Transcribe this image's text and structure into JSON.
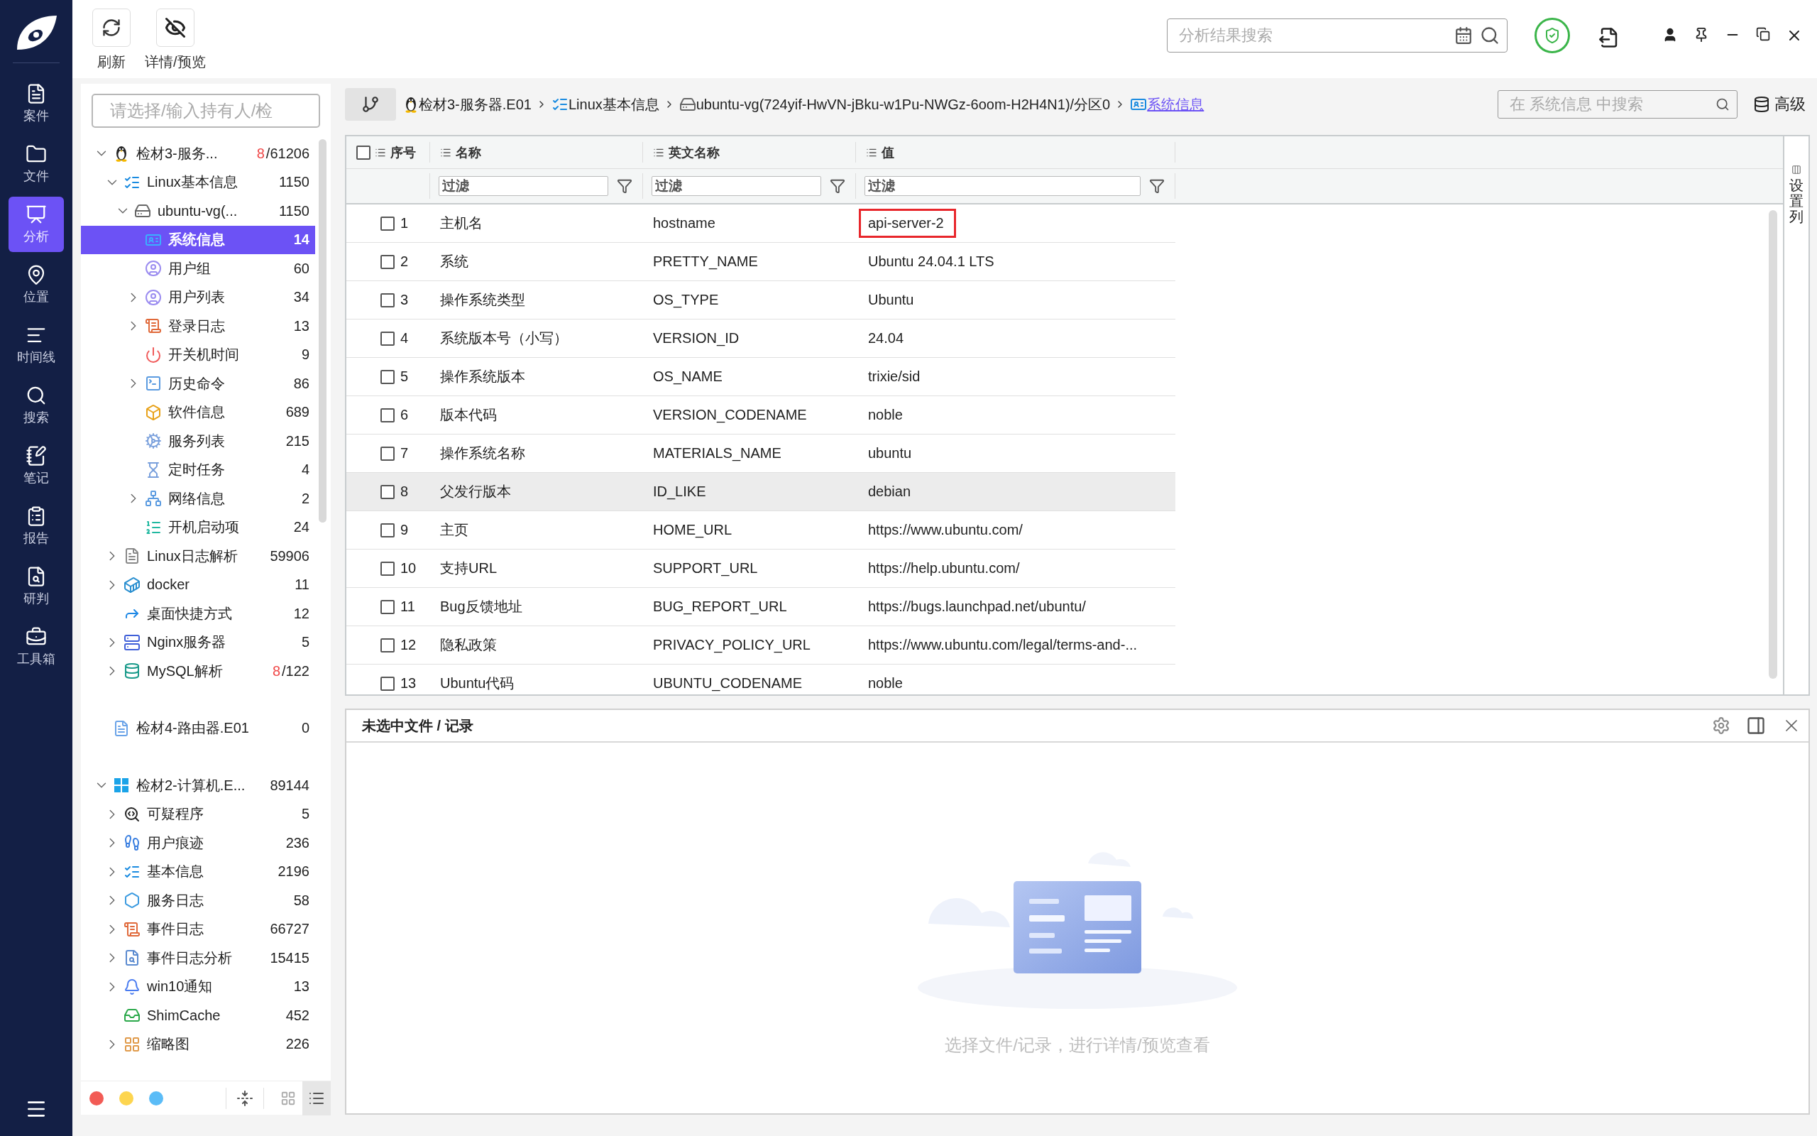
{
  "nav": {
    "items": [
      {
        "label": "案件",
        "selected": false
      },
      {
        "label": "文件",
        "selected": false
      },
      {
        "label": "分析",
        "selected": true
      },
      {
        "label": "位置",
        "selected": false
      },
      {
        "label": "时间线",
        "selected": false
      },
      {
        "label": "搜索",
        "selected": false
      },
      {
        "label": "笔记",
        "selected": false
      },
      {
        "label": "报告",
        "selected": false
      },
      {
        "label": "研判",
        "selected": false
      },
      {
        "label": "工具箱",
        "selected": false
      }
    ]
  },
  "toolbar": {
    "buttons": [
      {
        "kind": "refresh",
        "label": "刷新"
      },
      {
        "kind": "preview",
        "label": "详情/预览"
      }
    ],
    "search": {
      "placeholder": "分析结果搜索"
    }
  },
  "tree_panel": {
    "owner_select": {
      "placeholder": "请选择/输入持有人/检"
    },
    "tree": [
      {
        "label": "检材3-服务...",
        "kind": "linux",
        "alert": "8",
        "count": "/61206",
        "expanded": true,
        "selected": false,
        "children": [
          {
            "label": "Linux基本信息",
            "kind": "list",
            "count": "1150",
            "expanded": true,
            "selected": false,
            "children": [
              {
                "label": "ubuntu-vg(...",
                "kind": "disk",
                "count": "1150",
                "expanded": true,
                "selected": false,
                "children": [
                  {
                    "label": "系统信息",
                    "kind": "sysinfo",
                    "count": "14",
                    "selected": true
                  },
                  {
                    "label": "用户组",
                    "kind": "user",
                    "count": "60",
                    "selected": false
                  },
                  {
                    "label": "用户列表",
                    "kind": "user",
                    "count": "34",
                    "expanded": false,
                    "selected": false
                  },
                  {
                    "label": "登录日志",
                    "kind": "log-alert",
                    "count": "13",
                    "expanded": false,
                    "selected": false
                  },
                  {
                    "label": "开关机时间",
                    "kind": "power",
                    "count": "9",
                    "selected": false
                  },
                  {
                    "label": "历史命令",
                    "kind": "terminal",
                    "count": "86",
                    "expanded": false,
                    "selected": false
                  },
                  {
                    "label": "软件信息",
                    "kind": "cube",
                    "count": "689",
                    "selected": false
                  },
                  {
                    "label": "服务列表",
                    "kind": "gears",
                    "count": "215",
                    "selected": false
                  },
                  {
                    "label": "定时任务",
                    "kind": "hourglass",
                    "count": "4",
                    "selected": false
                  },
                  {
                    "label": "网络信息",
                    "kind": "network",
                    "count": "2",
                    "expanded": false,
                    "selected": false
                  },
                  {
                    "label": "开机启动项",
                    "kind": "startup",
                    "count": "24",
                    "selected": false
                  }
                ]
              }
            ]
          },
          {
            "label": "Linux日志解析",
            "kind": "logfile",
            "count": "59906",
            "expanded": false,
            "selected": false
          },
          {
            "label": "docker",
            "kind": "docker",
            "count": "11",
            "expanded": false,
            "selected": false
          },
          {
            "label": "桌面快捷方式",
            "kind": "shortcut",
            "count": "12",
            "selected": false
          },
          {
            "label": "Nginx服务器",
            "kind": "server",
            "count": "5",
            "expanded": false,
            "selected": false
          },
          {
            "label": "MySQL解析",
            "kind": "database",
            "alert": "8",
            "count": "/122",
            "expanded": false,
            "selected": false
          }
        ]
      },
      {
        "label": "检材4-路由器.E01",
        "kind": "file",
        "count": "0",
        "selected": false
      },
      {
        "label": "检材2-计算机.E...",
        "kind": "windows",
        "count": "89144",
        "expanded": true,
        "selected": false,
        "children": [
          {
            "label": "可疑程序",
            "kind": "suspicious",
            "count": "5",
            "expanded": false,
            "selected": false
          },
          {
            "label": "用户痕迹",
            "kind": "footprints",
            "count": "236",
            "expanded": false,
            "selected": false
          },
          {
            "label": "基本信息",
            "kind": "list",
            "count": "2196",
            "expanded": false,
            "selected": false
          },
          {
            "label": "服务日志",
            "kind": "service",
            "count": "58",
            "expanded": false,
            "selected": false
          },
          {
            "label": "事件日志",
            "kind": "log-alert",
            "count": "66727",
            "expanded": false,
            "selected": false
          },
          {
            "label": "事件日志分析",
            "kind": "log-search",
            "count": "15415",
            "expanded": false,
            "selected": false
          },
          {
            "label": "win10通知",
            "kind": "bell",
            "count": "13",
            "expanded": false,
            "selected": false
          },
          {
            "label": "ShimCache",
            "kind": "cache",
            "count": "452",
            "selected": false
          },
          {
            "label": "缩略图",
            "kind": "thumbnails",
            "count": "226",
            "expanded": false,
            "selected": false
          }
        ]
      }
    ],
    "color_filters": [
      {
        "color": "#f25b55"
      },
      {
        "color": "#fdd54f"
      },
      {
        "color": "#5bbcf7"
      }
    ],
    "views": [
      {
        "kind": "grid",
        "selected": false
      },
      {
        "kind": "list",
        "selected": true
      }
    ]
  },
  "breadcrumb": {
    "items": [
      {
        "label": "检材3-服务器.E01",
        "kind": "linux",
        "selected": false
      },
      {
        "label": "Linux基本信息",
        "kind": "list",
        "selected": false
      },
      {
        "label": "ubuntu-vg(724yif-HwVN-jBku-w1Pu-NWGz-6oom-H2H4N1)/分区0",
        "kind": "disk",
        "selected": false
      },
      {
        "label": "系统信息",
        "kind": "sysinfo",
        "selected": true
      }
    ],
    "search": {
      "placeholder": "在 系统信息 中搜索"
    },
    "advanced": "高级"
  },
  "table": {
    "select_all_checked": false,
    "columns": [
      {
        "label": "序号"
      },
      {
        "label": "名称",
        "placeholder": "过滤"
      },
      {
        "label": "英文名称",
        "placeholder": "过滤"
      },
      {
        "label": "值",
        "placeholder": "过滤"
      }
    ],
    "rows": [
      {
        "index": "1",
        "name": "主机名",
        "english_name": "hostname",
        "value": "api-server-2",
        "checked": false,
        "selected": false,
        "marked": true
      },
      {
        "index": "2",
        "name": "系统",
        "english_name": "PRETTY_NAME",
        "value": "Ubuntu 24.04.1 LTS",
        "checked": false,
        "selected": false,
        "marked": false
      },
      {
        "index": "3",
        "name": "操作系统类型",
        "english_name": "OS_TYPE",
        "value": "Ubuntu",
        "checked": false,
        "selected": false,
        "marked": false
      },
      {
        "index": "4",
        "name": "系统版本号（小写）",
        "english_name": "VERSION_ID",
        "value": "24.04",
        "checked": false,
        "selected": false,
        "marked": false
      },
      {
        "index": "5",
        "name": "操作系统版本",
        "english_name": "OS_NAME",
        "value": "trixie/sid",
        "checked": false,
        "selected": false,
        "marked": false
      },
      {
        "index": "6",
        "name": "版本代码",
        "english_name": "VERSION_CODENAME",
        "value": "noble",
        "checked": false,
        "selected": false,
        "marked": false
      },
      {
        "index": "7",
        "name": "操作系统名称",
        "english_name": "MATERIALS_NAME",
        "value": "ubuntu",
        "checked": false,
        "selected": false,
        "marked": false
      },
      {
        "index": "8",
        "name": "父发行版本",
        "english_name": "ID_LIKE",
        "value": "debian",
        "checked": false,
        "selected": true,
        "marked": false
      },
      {
        "index": "9",
        "name": "主页",
        "english_name": "HOME_URL",
        "value": "https://www.ubuntu.com/",
        "checked": false,
        "selected": false,
        "marked": false
      },
      {
        "index": "10",
        "name": "支持URL",
        "english_name": "SUPPORT_URL",
        "value": "https://help.ubuntu.com/",
        "checked": false,
        "selected": false,
        "marked": false
      },
      {
        "index": "11",
        "name": "Bug反馈地址",
        "english_name": "BUG_REPORT_URL",
        "value": "https://bugs.launchpad.net/ubuntu/",
        "checked": false,
        "selected": false,
        "marked": false
      },
      {
        "index": "12",
        "name": "隐私政策",
        "english_name": "PRIVACY_POLICY_URL",
        "value": "https://www.ubuntu.com/legal/terms-and-...",
        "checked": false,
        "selected": false,
        "marked": false
      },
      {
        "index": "13",
        "name": "Ubuntu代码",
        "english_name": "UBUNTU_CODENAME",
        "value": "noble",
        "checked": false,
        "selected": false,
        "marked": false
      }
    ],
    "column_settings": "设置列"
  },
  "preview": {
    "title": "未选中文件 / 记录",
    "empty_text": "选择文件/记录，进行详情/预览查看"
  }
}
